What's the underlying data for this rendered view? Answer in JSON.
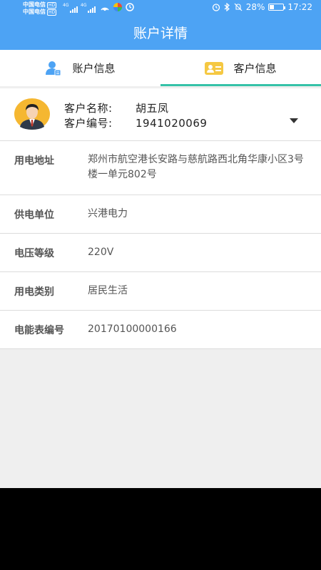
{
  "status_bar": {
    "carrier_1": "中国电信",
    "carrier_2": "中国电信",
    "hd_badge": "HD",
    "network_1": "4G",
    "network_2": "4G",
    "battery_percent": "28%",
    "battery_level": 0.28,
    "time": "17:22"
  },
  "header": {
    "title": "账户详情"
  },
  "tabs": [
    {
      "label": "账户信息",
      "icon": "account-user-icon",
      "active": false
    },
    {
      "label": "客户信息",
      "icon": "id-card-icon",
      "active": true
    }
  ],
  "customer": {
    "name_label": "客户名称:",
    "name_value": "胡五凤",
    "code_label": "客户编号:",
    "code_value": "1941020069"
  },
  "details": [
    {
      "key": "用电地址",
      "value": "郑州市航空港长安路与慈航路西北角华康小区3号楼一单元802号"
    },
    {
      "key": "供电单位",
      "value": "兴港电力"
    },
    {
      "key": "电压等级",
      "value": "220V"
    },
    {
      "key": "用电类别",
      "value": "居民生活"
    },
    {
      "key": "电能表编号",
      "value": "20170100000166"
    }
  ],
  "colors": {
    "primary": "#4da3f4",
    "tab_indicator": "#35c2a8",
    "card_icon": "#f5c842"
  }
}
